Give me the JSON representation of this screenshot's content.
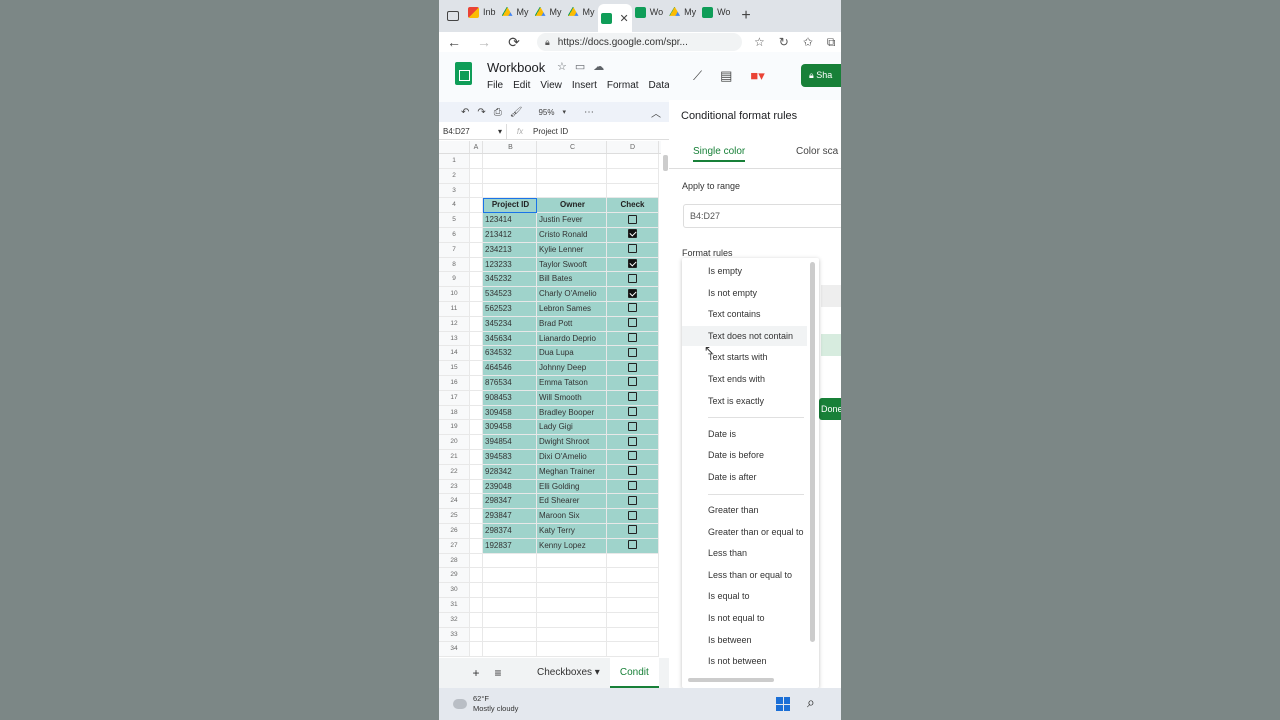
{
  "browser": {
    "tabs": [
      {
        "label": "Inb",
        "icon": "gmail-icon"
      },
      {
        "label": "My",
        "icon": "drive-icon"
      },
      {
        "label": "My",
        "icon": "drive-icon"
      },
      {
        "label": "My",
        "icon": "drive-icon"
      },
      {
        "label": "",
        "icon": "sheets-icon",
        "active": true
      },
      {
        "label": "Wo",
        "icon": "sheets-icon"
      },
      {
        "label": "My",
        "icon": "drive-icon"
      },
      {
        "label": "Wo",
        "icon": "sheets-icon"
      }
    ],
    "url": "https://docs.google.com/spr..."
  },
  "sheets": {
    "title": "Workbook",
    "menu": [
      "File",
      "Edit",
      "View",
      "Insert",
      "Format",
      "Data"
    ],
    "zoom": "95%",
    "namebox": "B4:D27",
    "formula": "Project ID",
    "share_label": "Sha",
    "columns": [
      "A",
      "B",
      "C",
      "D"
    ],
    "headers": {
      "id": "Project ID",
      "owner": "Owner",
      "check": "Check"
    },
    "rows": [
      {
        "id": "123414",
        "owner": "Justin Fever",
        "checked": false
      },
      {
        "id": "213412",
        "owner": "Cristo Ronald",
        "checked": true
      },
      {
        "id": "234213",
        "owner": "Kylie Lenner",
        "checked": false
      },
      {
        "id": "123233",
        "owner": "Taylor Swooft",
        "checked": true
      },
      {
        "id": "345232",
        "owner": "Bill Bates",
        "checked": false
      },
      {
        "id": "534523",
        "owner": "Charly O'Amelio",
        "checked": true
      },
      {
        "id": "562523",
        "owner": "Lebron Sames",
        "checked": false
      },
      {
        "id": "345234",
        "owner": "Brad Pott",
        "checked": false
      },
      {
        "id": "345634",
        "owner": "Lianardo Deprio",
        "checked": false
      },
      {
        "id": "634532",
        "owner": "Dua Lupa",
        "checked": false
      },
      {
        "id": "464546",
        "owner": "Johnny Deep",
        "checked": false
      },
      {
        "id": "876534",
        "owner": "Emma Tatson",
        "checked": false
      },
      {
        "id": "908453",
        "owner": "Will Smooth",
        "checked": false
      },
      {
        "id": "309458",
        "owner": "Bradley Booper",
        "checked": false
      },
      {
        "id": "309458",
        "owner": "Lady Gigi",
        "checked": false
      },
      {
        "id": "394854",
        "owner": "Dwight Shroot",
        "checked": false
      },
      {
        "id": "394583",
        "owner": "Dixi O'Amelio",
        "checked": false
      },
      {
        "id": "928342",
        "owner": "Meghan Trainer",
        "checked": false
      },
      {
        "id": "239048",
        "owner": "Elli Golding",
        "checked": false
      },
      {
        "id": "298347",
        "owner": "Ed Shearer",
        "checked": false
      },
      {
        "id": "293847",
        "owner": "Maroon Six",
        "checked": false
      },
      {
        "id": "298374",
        "owner": "Katy Terry",
        "checked": false
      },
      {
        "id": "192837",
        "owner": "Kenny Lopez",
        "checked": false
      }
    ],
    "sheet_tabs": [
      {
        "label": "Checkboxes",
        "active": false
      },
      {
        "label": "Condit",
        "active": true
      }
    ]
  },
  "panel": {
    "title": "Conditional format rules",
    "tab_single": "Single color",
    "tab_scale": "Color sca",
    "apply_label": "Apply to range",
    "range": "B4:D27",
    "rules_label": "Format rules",
    "done_label": "Done"
  },
  "dropdown": {
    "groups": [
      [
        "Is empty",
        "Is not empty",
        "Text contains",
        "Text does not contain",
        "Text starts with",
        "Text ends with",
        "Text is exactly"
      ],
      [
        "Date is",
        "Date is before",
        "Date is after"
      ],
      [
        "Greater than",
        "Greater than or equal to",
        "Less than",
        "Less than or equal to",
        "Is equal to",
        "Is not equal to",
        "Is between",
        "Is not between"
      ]
    ],
    "hovered": "Text does not contain"
  },
  "taskbar": {
    "temp": "62°F",
    "weather": "Mostly cloudy"
  },
  "colors": {
    "accent": "#188038",
    "selection": "#9fd3cb",
    "background": "#7c8786"
  }
}
